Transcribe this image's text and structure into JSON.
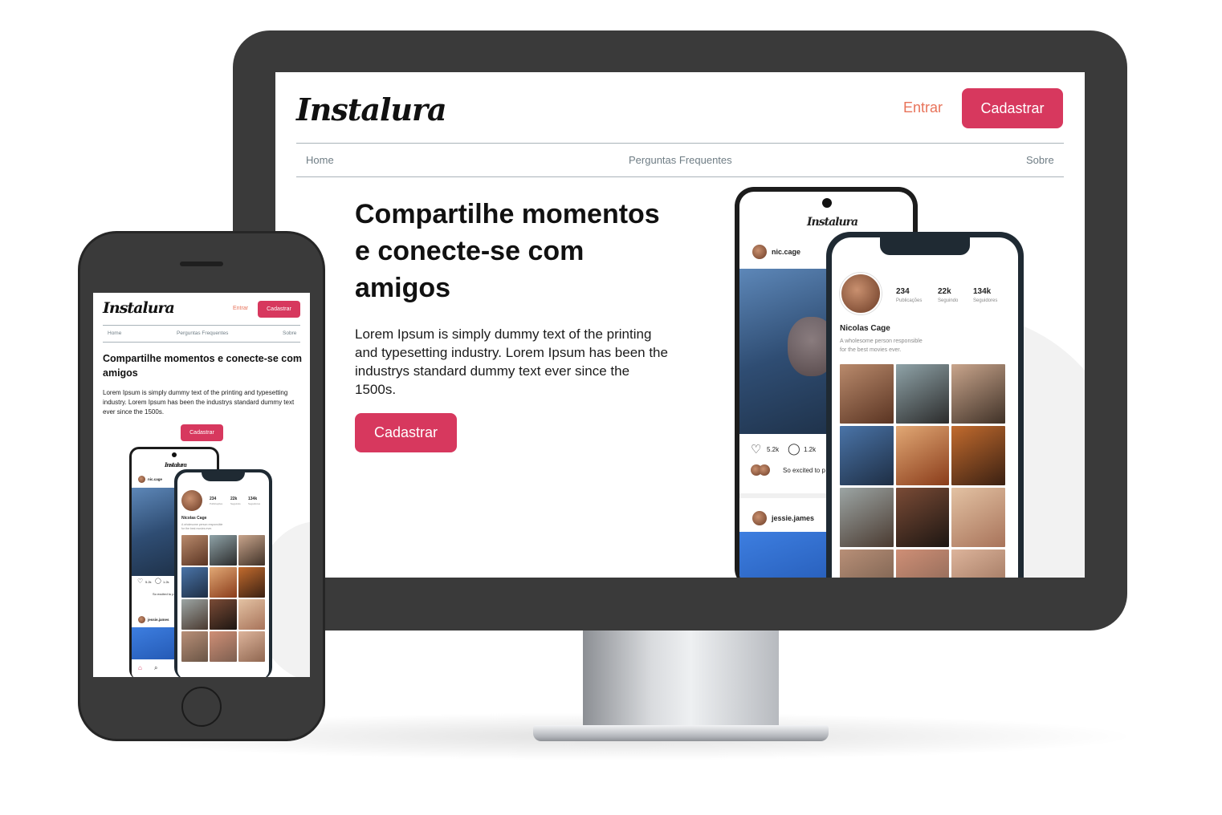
{
  "brand": {
    "logo": "Instalura",
    "accent": "#d7385e",
    "link_color": "#e8735a"
  },
  "header": {
    "login_label": "Entrar",
    "signup_label": "Cadastrar"
  },
  "nav": {
    "items": [
      "Home",
      "Perguntas Frequentes",
      "Sobre"
    ]
  },
  "hero": {
    "title": "Compartilhe momentos e conecte-se com amigos",
    "description": "Lorem Ipsum is simply dummy text of the printing and typesetting industry. Lorem Ipsum has been the industrys standard dummy text ever since the 1500s.",
    "cta_label": "Cadastrar"
  },
  "illustration": {
    "feed": {
      "logo": "Instalura",
      "post_user": "nic.cage",
      "likes": "5.2k",
      "comments": "1.2k",
      "caption": "So excited to p",
      "next_user": "jessie.james"
    },
    "profile": {
      "stats": [
        {
          "value": "234",
          "label": "Publicações"
        },
        {
          "value": "22k",
          "label": "Seguindo"
        },
        {
          "value": "134k",
          "label": "Seguidores"
        }
      ],
      "name": "Nicolas Cage",
      "bio_line1": "A wholesome person responsible",
      "bio_line2": "for the best movies ever."
    }
  },
  "icons": [
    "heart-icon",
    "comment-icon",
    "home-icon",
    "search-icon"
  ]
}
